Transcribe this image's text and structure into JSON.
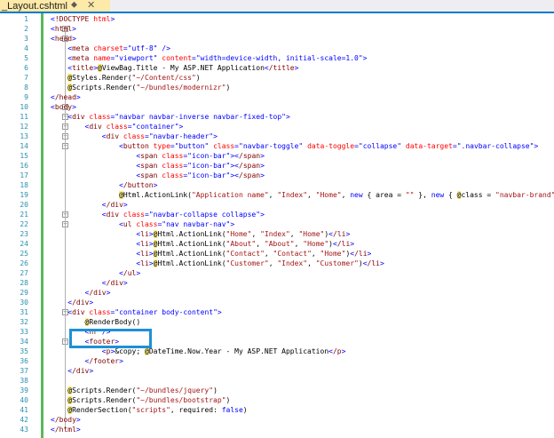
{
  "tab": {
    "title": "_Layout.cshtml",
    "pin_icon": "pin-icon",
    "close_icon": "close-icon"
  },
  "colors": {
    "tab_active": "#fde9a8",
    "accent": "#007acc",
    "line_number": "#2b91af",
    "tag": "#800000",
    "attribute": "#ff0000",
    "value": "#0000ff",
    "string": "#a31515",
    "razor_highlight": "#ffee80",
    "selection_box": "#1e90d6"
  },
  "lines": [
    {
      "n": "1",
      "text": "<!DOCTYPE html>"
    },
    {
      "n": "2",
      "text": "<html>"
    },
    {
      "n": "3",
      "text": "<head>"
    },
    {
      "n": "4",
      "text": "    <meta charset=\"utf-8\" />"
    },
    {
      "n": "5",
      "text": "    <meta name=\"viewport\" content=\"width=device-width, initial-scale=1.0\">"
    },
    {
      "n": "6",
      "text": "    <title>@ViewBag.Title - My ASP.NET Application</title>"
    },
    {
      "n": "7",
      "text": "    @Styles.Render(\"~/Content/css\")"
    },
    {
      "n": "8",
      "text": "    @Scripts.Render(\"~/bundles/modernizr\")"
    },
    {
      "n": "9",
      "text": "</head>"
    },
    {
      "n": "10",
      "text": "<body>"
    },
    {
      "n": "11",
      "text": "    <div class=\"navbar navbar-inverse navbar-fixed-top\">"
    },
    {
      "n": "12",
      "text": "        <div class=\"container\">"
    },
    {
      "n": "13",
      "text": "            <div class=\"navbar-header\">"
    },
    {
      "n": "14",
      "text": "                <button type=\"button\" class=\"navbar-toggle\" data-toggle=\"collapse\" data-target=\".navbar-collapse\">"
    },
    {
      "n": "15",
      "text": "                    <span class=\"icon-bar\"></span>"
    },
    {
      "n": "16",
      "text": "                    <span class=\"icon-bar\"></span>"
    },
    {
      "n": "17",
      "text": "                    <span class=\"icon-bar\"></span>"
    },
    {
      "n": "18",
      "text": "                </button>"
    },
    {
      "n": "19",
      "text": "                @Html.ActionLink(\"Application name\", \"Index\", \"Home\", new { area = \"\" }, new { @class = \"navbar-brand\" })"
    },
    {
      "n": "20",
      "text": "            </div>"
    },
    {
      "n": "21",
      "text": "            <div class=\"navbar-collapse collapse\">"
    },
    {
      "n": "22",
      "text": "                <ul class=\"nav navbar-nav\">"
    },
    {
      "n": "23",
      "text": "                    <li>@Html.ActionLink(\"Home\", \"Index\", \"Home\")</li>"
    },
    {
      "n": "24",
      "text": "                    <li>@Html.ActionLink(\"About\", \"About\", \"Home\")</li>"
    },
    {
      "n": "25",
      "text": "                    <li>@Html.ActionLink(\"Contact\", \"Contact\", \"Home\")</li>"
    },
    {
      "n": "26",
      "text": "                    <li>@Html.ActionLink(\"Customer\", \"Index\", \"Customer\")</li>"
    },
    {
      "n": "27",
      "text": "                </ul>"
    },
    {
      "n": "28",
      "text": "            </div>"
    },
    {
      "n": "29",
      "text": "        </div>"
    },
    {
      "n": "30",
      "text": "    </div>"
    },
    {
      "n": "31",
      "text": "    <div class=\"container body-content\">"
    },
    {
      "n": "32",
      "text": "        @RenderBody()"
    },
    {
      "n": "33",
      "text": "        <hr />"
    },
    {
      "n": "34",
      "text": "        <footer>"
    },
    {
      "n": "35",
      "text": "            <p>&copy; @DateTime.Now.Year - My ASP.NET Application</p>"
    },
    {
      "n": "36",
      "text": "        </footer>"
    },
    {
      "n": "37",
      "text": "    </div>"
    },
    {
      "n": "38",
      "text": ""
    },
    {
      "n": "39",
      "text": "    @Scripts.Render(\"~/bundles/jquery\")"
    },
    {
      "n": "40",
      "text": "    @Scripts.Render(\"~/bundles/bootstrap\")"
    },
    {
      "n": "41",
      "text": "    @RenderSection(\"scripts\", required: false)"
    },
    {
      "n": "42",
      "text": "</body>"
    },
    {
      "n": "43",
      "text": "</html>"
    }
  ]
}
